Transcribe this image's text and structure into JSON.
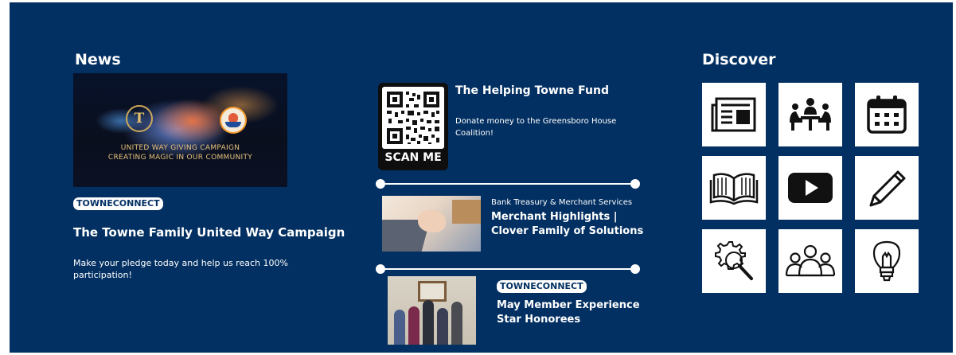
{
  "news": {
    "heading": "News",
    "image_caption_line1": "UNITED WAY GIVING CAMPAIGN",
    "image_caption_line2": "CREATING MAGIC IN OUR COMMUNITY",
    "badge": "TOWNECONNECT",
    "title": "The Towne Family United Way Campaign",
    "body_line1": "Make your pledge today and help us reach 100%",
    "body_line2": "participation!"
  },
  "fund": {
    "scan_label": "SCAN ME",
    "title": "The Helping Towne Fund",
    "body_line1": "Donate money to the Greensboro House",
    "body_line2": "Coalition!"
  },
  "merchant": {
    "category": "Bank Treasury & Merchant Services",
    "title_line1": "Merchant Highlights |",
    "title_line2": "Clover Family of Solutions"
  },
  "member": {
    "badge": "TOWNECONNECT",
    "title_line1": "May Member Experience",
    "title_line2": "Star Honorees"
  },
  "discover": {
    "heading": "Discover",
    "tiles": [
      {
        "icon": "newspaper-icon"
      },
      {
        "icon": "meeting-icon"
      },
      {
        "icon": "calendar-icon"
      },
      {
        "icon": "open-book-icon"
      },
      {
        "icon": "video-play-icon"
      },
      {
        "icon": "pencil-icon"
      },
      {
        "icon": "gear-search-icon"
      },
      {
        "icon": "group-icon"
      },
      {
        "icon": "lightbulb-icon"
      }
    ]
  },
  "colors": {
    "background": "#033062",
    "text": "#ffffff",
    "tile": "#ffffff"
  }
}
